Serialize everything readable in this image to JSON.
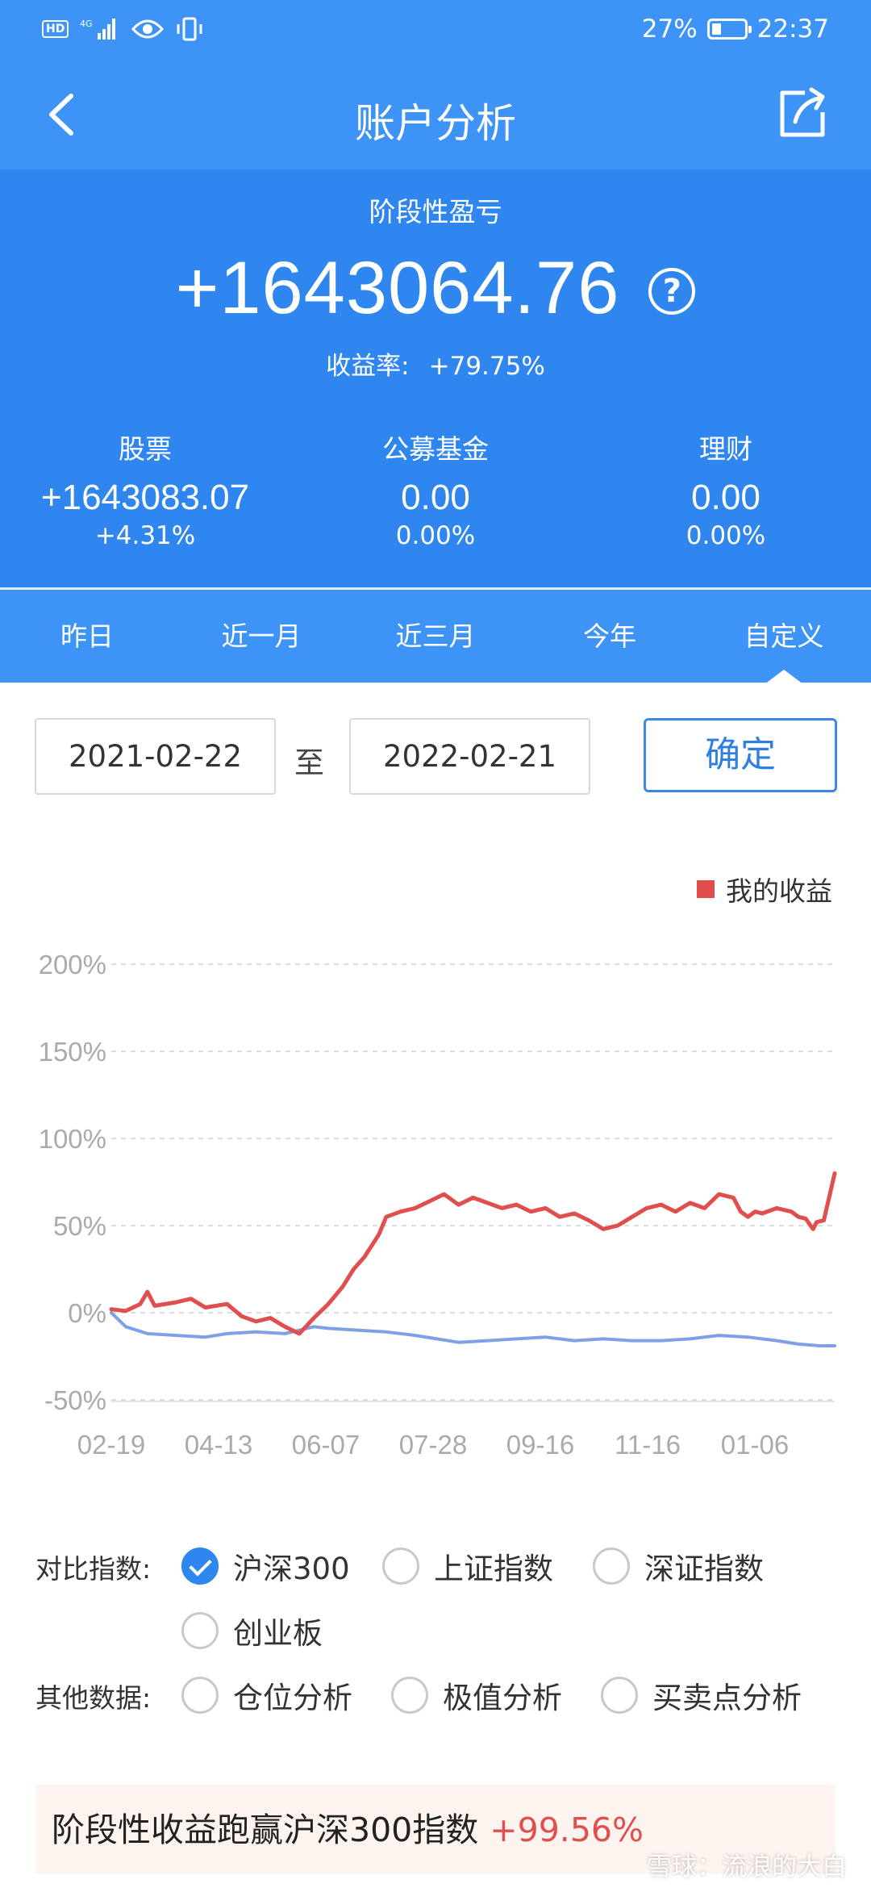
{
  "status_bar": {
    "left_icons": [
      "hd-icon",
      "4g-signal-icon",
      "eye-icon",
      "vibrate-icon"
    ],
    "battery": "27%",
    "time": "22:37"
  },
  "header": {
    "title": "账户分析",
    "back_icon": "back-arrow-icon",
    "share_icon": "share-icon"
  },
  "summary": {
    "label": "阶段性盈亏",
    "value": "+1643064.76",
    "rate_label": "收益率:",
    "rate_value": "+79.75%",
    "columns": [
      {
        "label": "股票",
        "value": "+1643083.07",
        "pct": "+4.31%"
      },
      {
        "label": "公募基金",
        "value": "0.00",
        "pct": "0.00%"
      },
      {
        "label": "理财",
        "value": "0.00",
        "pct": "0.00%"
      }
    ]
  },
  "tabs": [
    "昨日",
    "近一月",
    "近三月",
    "今年",
    "自定义"
  ],
  "active_tab": 4,
  "date_range": {
    "start": "2021-02-22",
    "separator": "至",
    "end": "2022-02-21",
    "confirm": "确定"
  },
  "colors": {
    "primary": "#3d94f6",
    "summary_bg": "#2f86ef",
    "my_return": "#e04f4d",
    "index": "#7ea0e6"
  },
  "chart_data": {
    "type": "line",
    "legend": "我的收益",
    "x_ticks": [
      "02-19",
      "04-13",
      "06-07",
      "07-28",
      "09-16",
      "11-16",
      "01-06"
    ],
    "y_ticks": [
      "200%",
      "150%",
      "100%",
      "50%",
      "0%",
      "-50%"
    ],
    "ylim": [
      -50,
      200
    ],
    "grid": true,
    "series": [
      {
        "name": "我的收益",
        "color": "#e04f4d",
        "x": [
          0,
          0.02,
          0.04,
          0.05,
          0.06,
          0.09,
          0.11,
          0.13,
          0.16,
          0.18,
          0.2,
          0.22,
          0.24,
          0.26,
          0.28,
          0.3,
          0.32,
          0.335,
          0.35,
          0.37,
          0.38,
          0.4,
          0.42,
          0.44,
          0.46,
          0.48,
          0.5,
          0.52,
          0.54,
          0.56,
          0.58,
          0.6,
          0.62,
          0.64,
          0.66,
          0.68,
          0.7,
          0.72,
          0.74,
          0.76,
          0.78,
          0.8,
          0.82,
          0.84,
          0.86,
          0.87,
          0.88,
          0.89,
          0.9,
          0.92,
          0.94,
          0.95,
          0.96,
          0.97,
          0.975,
          0.985,
          1.0
        ],
        "values": [
          2,
          1,
          5,
          12,
          4,
          6,
          8,
          3,
          5,
          -2,
          -5,
          -3,
          -8,
          -12,
          -3,
          5,
          15,
          25,
          32,
          45,
          55,
          58,
          60,
          64,
          68,
          62,
          66,
          63,
          60,
          62,
          58,
          60,
          55,
          57,
          53,
          48,
          50,
          55,
          60,
          62,
          58,
          63,
          60,
          68,
          66,
          58,
          55,
          58,
          57,
          60,
          58,
          55,
          54,
          48,
          52,
          53,
          80
        ]
      },
      {
        "name": "沪深300",
        "color": "#7ea0e6",
        "x": [
          0,
          0.02,
          0.05,
          0.09,
          0.13,
          0.16,
          0.2,
          0.24,
          0.28,
          0.3,
          0.34,
          0.38,
          0.42,
          0.45,
          0.48,
          0.52,
          0.56,
          0.6,
          0.64,
          0.68,
          0.72,
          0.76,
          0.8,
          0.84,
          0.88,
          0.92,
          0.95,
          0.98,
          1.0
        ],
        "values": [
          0,
          -8,
          -12,
          -13,
          -14,
          -12,
          -11,
          -12,
          -8,
          -9,
          -10,
          -11,
          -13,
          -15,
          -17,
          -16,
          -15,
          -14,
          -16,
          -15,
          -16,
          -16,
          -15,
          -13,
          -14,
          -16,
          -18,
          -19,
          -19
        ]
      }
    ]
  },
  "compare": {
    "label": "对比指数:",
    "options": [
      {
        "label": "沪深300",
        "checked": true
      },
      {
        "label": "上证指数",
        "checked": false
      },
      {
        "label": "深证指数",
        "checked": false
      },
      {
        "label": "创业板",
        "checked": false
      }
    ]
  },
  "other": {
    "label": "其他数据:",
    "options": [
      {
        "label": "仓位分析",
        "checked": false
      },
      {
        "label": "极值分析",
        "checked": false
      },
      {
        "label": "买卖点分析",
        "checked": false
      }
    ]
  },
  "banner": {
    "text": "阶段性收益跑赢沪深300指数",
    "pct": "+99.56%"
  },
  "watermark": "雪球：流浪的大白"
}
